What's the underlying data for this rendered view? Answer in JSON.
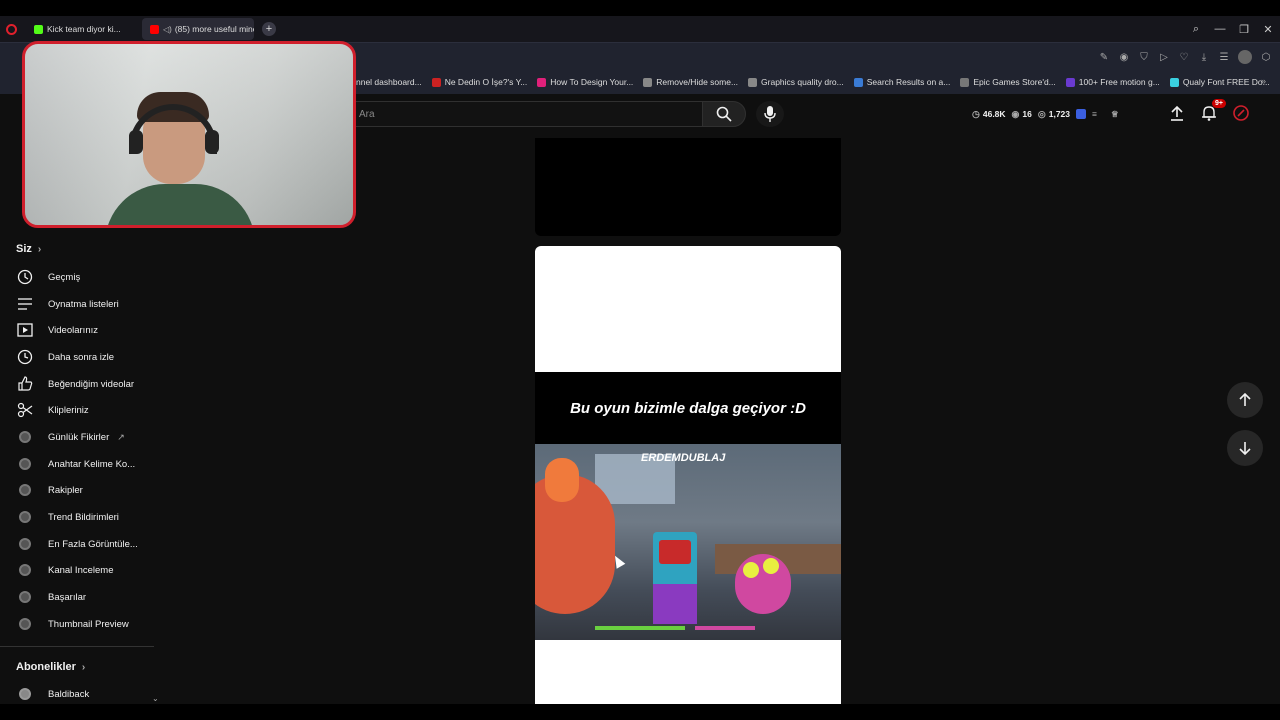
{
  "browser": {
    "tabs": [
      {
        "label": "Kick team diyor ki...",
        "favicon_color": "#53fc18"
      },
      {
        "label": "(85) more useful mine",
        "favicon_color": "#ff0000"
      }
    ],
    "bookmarks": [
      {
        "label": "nnel dashboard...",
        "color": "#444444"
      },
      {
        "label": "Ne Dedin O İşe?'s Y...",
        "color": "#cc2222"
      },
      {
        "label": "How To Design Your...",
        "color": "#e0207a"
      },
      {
        "label": "Remove/Hide some...",
        "color": "#888888"
      },
      {
        "label": "Graphics quality dro...",
        "color": "#888888"
      },
      {
        "label": "Search Results on a...",
        "color": "#3a7bd5"
      },
      {
        "label": "Epic Games Store'd...",
        "color": "#777777"
      },
      {
        "label": "100+ Free motion g...",
        "color": "#6a3ad0"
      },
      {
        "label": "Qualy Font FREE Do...",
        "color": "#3ad0e0"
      }
    ]
  },
  "youtube": {
    "search_placeholder": "Ara",
    "stats": {
      "views": "46.8K",
      "likes": "16",
      "count": "1,723"
    },
    "notifications_badge": "9+"
  },
  "sidebar": {
    "you_heading": "Siz",
    "items": [
      {
        "label": "Geçmiş",
        "icon": "history-icon"
      },
      {
        "label": "Oynatma listeleri",
        "icon": "playlist-icon"
      },
      {
        "label": "Videolarınız",
        "icon": "video-icon"
      },
      {
        "label": "Daha sonra izle",
        "icon": "clock-icon"
      },
      {
        "label": "Beğendiğim videolar",
        "icon": "thumbs-up-icon"
      },
      {
        "label": "Klipleriniz",
        "icon": "scissors-icon"
      }
    ],
    "ext_items": [
      {
        "label": "Günlük Fikirler"
      },
      {
        "label": "Anahtar Kelime Ko..."
      },
      {
        "label": "Rakipler"
      },
      {
        "label": "Trend Bildirimleri"
      },
      {
        "label": "En Fazla Görüntüle..."
      },
      {
        "label": "Kanal Inceleme"
      },
      {
        "label": "Başarılar"
      },
      {
        "label": "Thumbnail Preview"
      }
    ],
    "subs_heading": "Abonelikler",
    "subs": [
      {
        "label": "Baldiback"
      }
    ]
  },
  "short": {
    "caption": "Bu oyun bizimle dalga geçiyor :D",
    "watermark": "ERDEMDUBLAJ"
  }
}
